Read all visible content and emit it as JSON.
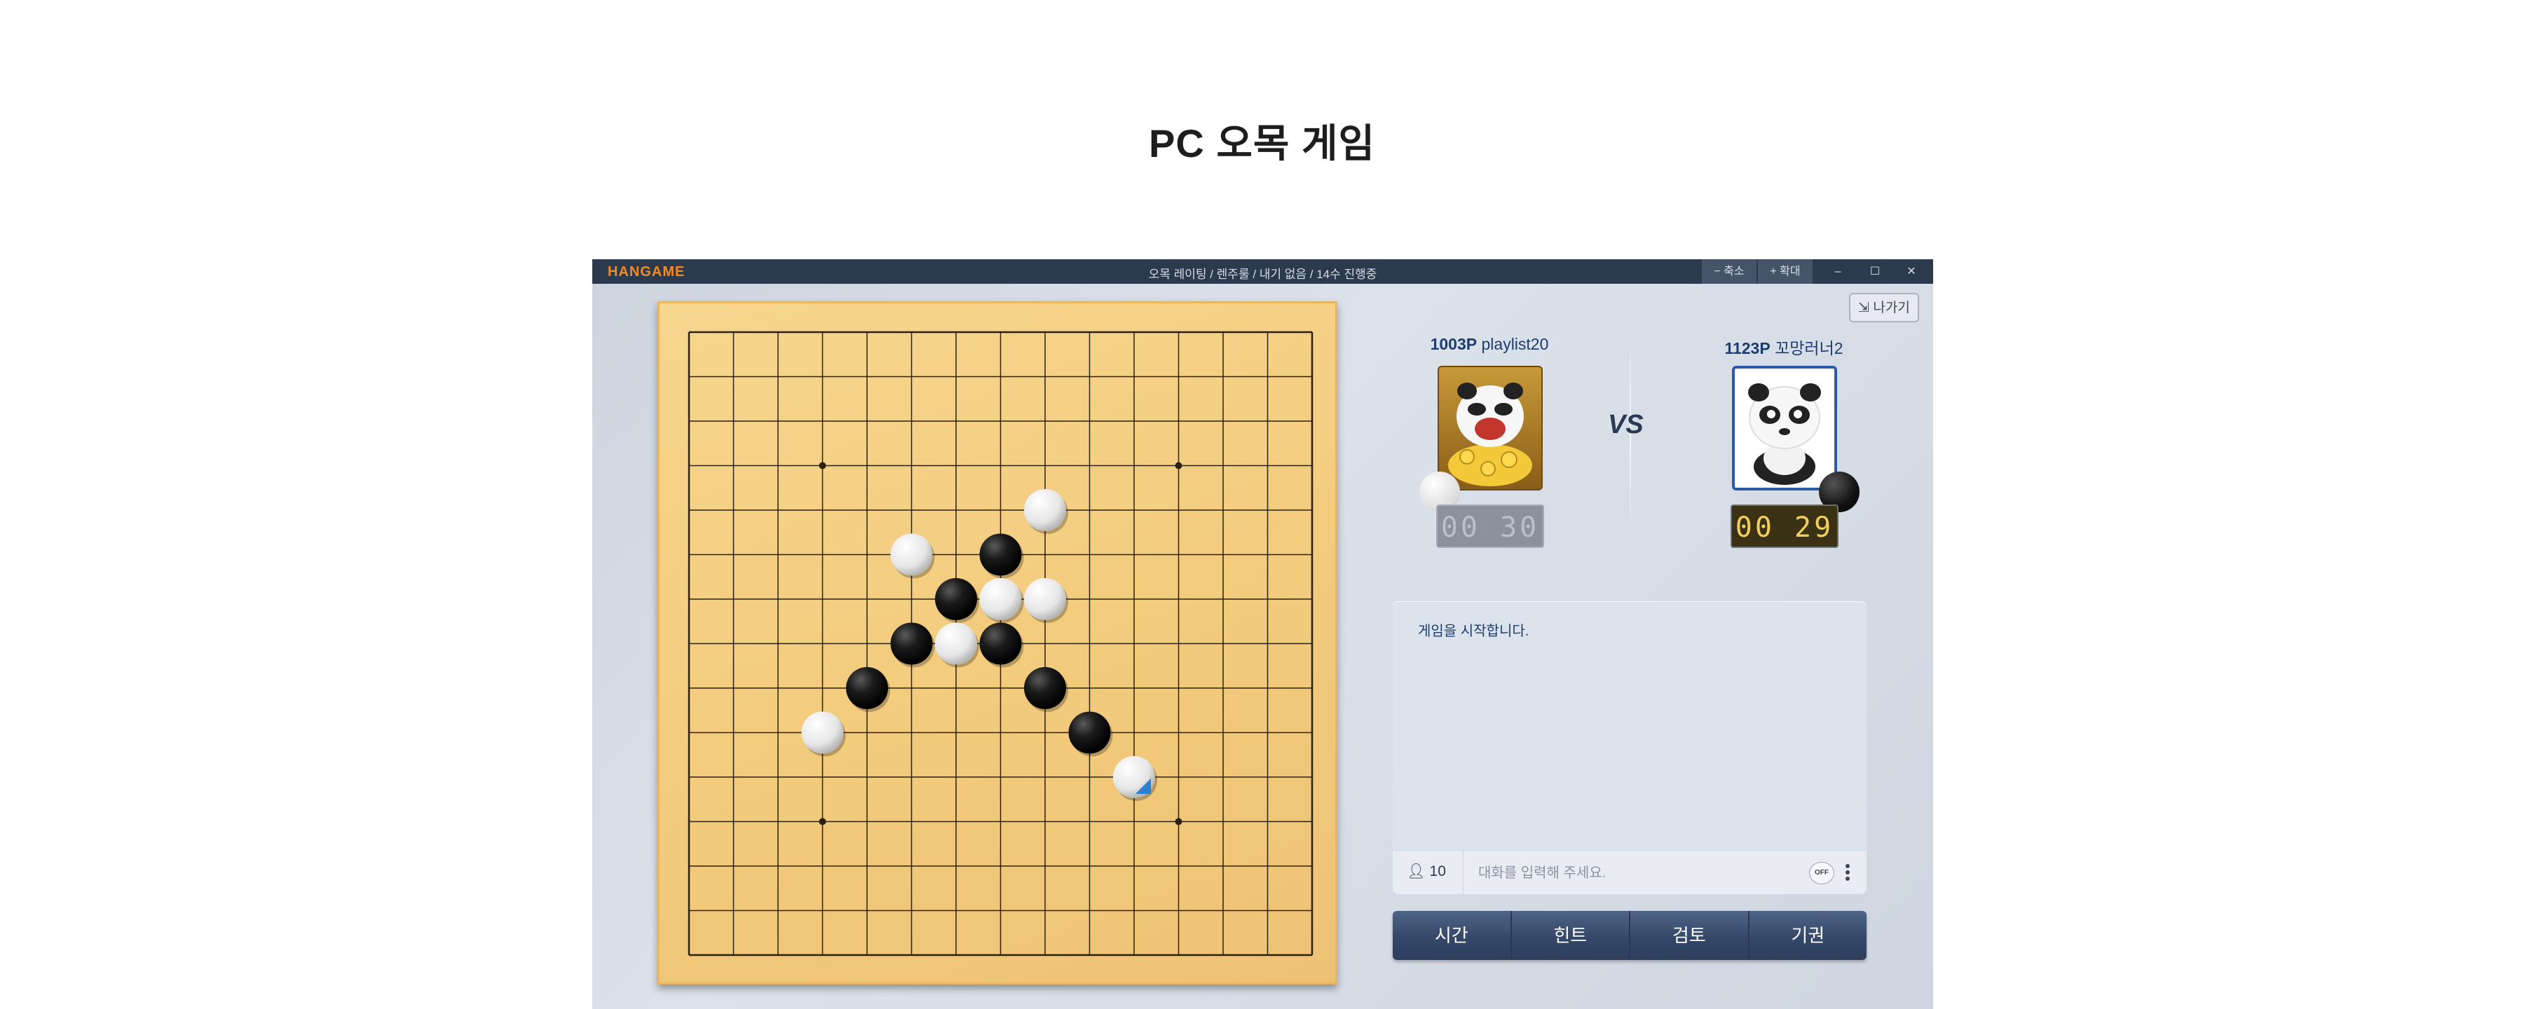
{
  "page": {
    "title": "PC 오목 게임"
  },
  "window": {
    "logo": "HANGAME",
    "title": "오목 레이팅 / 렌주룰 / 내기 없음 / 14수 진행중",
    "minimize_label": "− 축소",
    "maximize_label": "+ 확대",
    "min_glyph": "–",
    "restore_glyph": "☐",
    "close_glyph": "✕",
    "exit_label": "나가기"
  },
  "players": {
    "left": {
      "points": "1003P",
      "name": "playlist20",
      "timer": "00 30",
      "stone": "white"
    },
    "vs": "VS",
    "right": {
      "points": "1123P",
      "name": "꼬망러너2",
      "timer": "00 29",
      "stone": "black"
    }
  },
  "board": {
    "size": 15,
    "star_points": [
      [
        3,
        3
      ],
      [
        3,
        11
      ],
      [
        11,
        3
      ],
      [
        11,
        11
      ]
    ],
    "stones": [
      {
        "c": 8,
        "r": 4,
        "color": "white"
      },
      {
        "c": 5,
        "r": 5,
        "color": "white"
      },
      {
        "c": 7,
        "r": 5,
        "color": "black"
      },
      {
        "c": 6,
        "r": 6,
        "color": "black"
      },
      {
        "c": 7,
        "r": 6,
        "color": "white"
      },
      {
        "c": 8,
        "r": 6,
        "color": "white"
      },
      {
        "c": 5,
        "r": 7,
        "color": "black"
      },
      {
        "c": 6,
        "r": 7,
        "color": "white"
      },
      {
        "c": 7,
        "r": 7,
        "color": "black"
      },
      {
        "c": 4,
        "r": 8,
        "color": "black"
      },
      {
        "c": 8,
        "r": 8,
        "color": "black"
      },
      {
        "c": 3,
        "r": 9,
        "color": "white"
      },
      {
        "c": 9,
        "r": 9,
        "color": "black"
      },
      {
        "c": 10,
        "r": 10,
        "color": "white",
        "last": true
      }
    ]
  },
  "chat": {
    "message": "게임을 시작합니다.",
    "user_count": "10",
    "placeholder": "대화를 입력해 주세요.",
    "toggle": "OFF"
  },
  "actions": [
    "시간",
    "힌트",
    "검토",
    "기권"
  ],
  "colors": {
    "titlebar": "#2c3a4d",
    "logo": "#f08a22",
    "accent": "#1c3d6e"
  }
}
